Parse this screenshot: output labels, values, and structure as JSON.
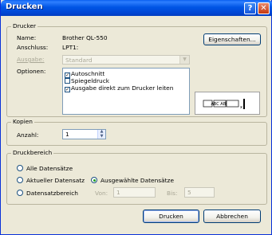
{
  "window": {
    "title": "Drucken",
    "help_glyph": "?",
    "close_glyph": "✕"
  },
  "printer": {
    "legend": "Drucker",
    "name_label": "Name:",
    "name_value": "Brother QL-550",
    "port_label": "Anschluss:",
    "port_value": "LPT1:",
    "properties_button": "Eigenschaften...",
    "output_label": "Ausgabe:",
    "output_value": "Standard",
    "options_label": "Optionen:",
    "options": [
      {
        "label": "Autoschnitt",
        "checked": true
      },
      {
        "label": "Spiegeldruck",
        "checked": false
      },
      {
        "label": "Ausgabe direkt zum Drucker leiten",
        "checked": true
      }
    ],
    "preview_text": "ABC ABC"
  },
  "copies": {
    "legend": "Kopien",
    "count_label": "Anzahl:",
    "count_value": "1"
  },
  "range": {
    "legend": "Druckbereich",
    "all_label": "Alle Datensätze",
    "current_label": "Aktueller Datensatz",
    "selected_label": "Ausgewählte Datensätze",
    "range_label": "Datensatzbereich",
    "from_label": "Von:",
    "from_value": "1",
    "to_label": "Bis:",
    "to_value": "5",
    "selected_option": "selected"
  },
  "buttons": {
    "print": "Drucken",
    "cancel": "Abbrechen"
  }
}
